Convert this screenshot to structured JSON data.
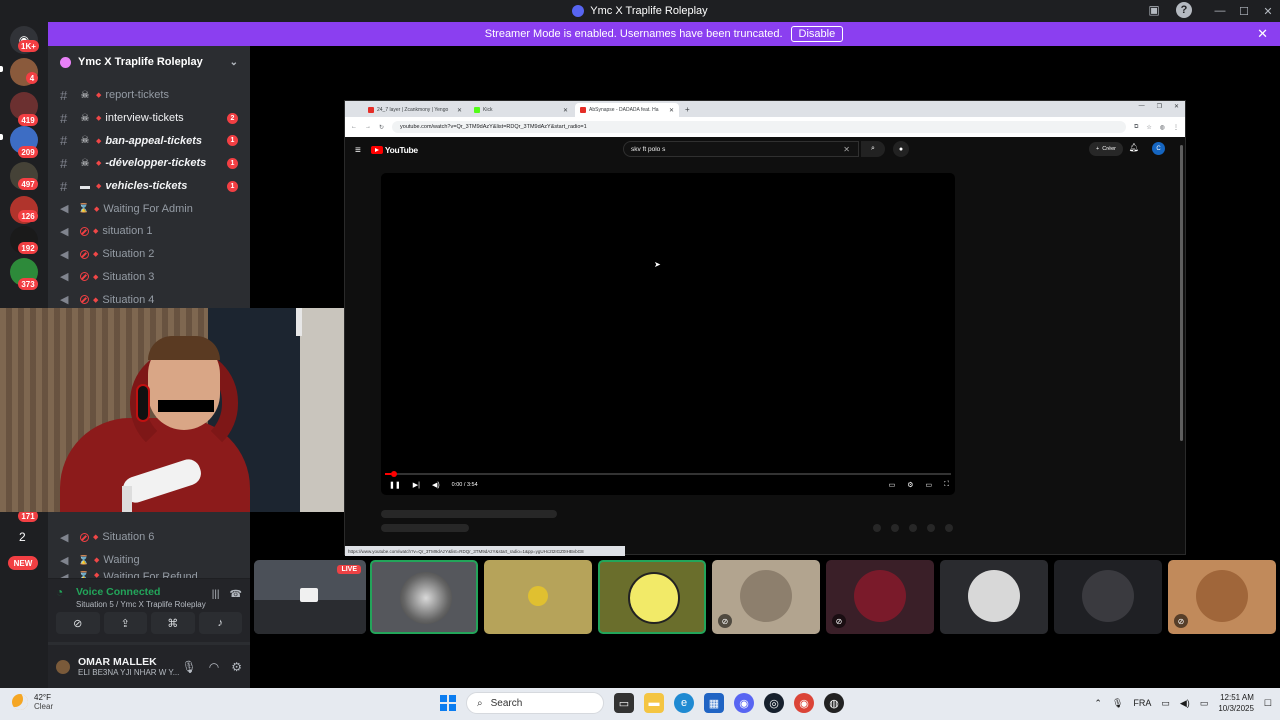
{
  "app": {
    "window_title": "Ymc X Traplife Roleplay"
  },
  "banner": {
    "text": "Streamer Mode is enabled. Usernames have been truncated.",
    "button": "Disable"
  },
  "rail": {
    "badges": [
      "1K+",
      "4",
      "419",
      "209",
      "497",
      "126",
      "192",
      "373",
      "171",
      "2",
      "NEW"
    ]
  },
  "server": {
    "name": "Ymc X Traplife Roleplay"
  },
  "channels": [
    {
      "type": "text",
      "name": "report-tickets",
      "style": "muted"
    },
    {
      "type": "text",
      "name": "interview-tickets",
      "style": "unread",
      "mentions": "2"
    },
    {
      "type": "text",
      "name": "ban-appeal-tickets",
      "style": "bolditalic",
      "mentions": "1"
    },
    {
      "type": "text",
      "name": "-développer-tickets",
      "style": "bolditalic",
      "mentions": "1"
    },
    {
      "type": "text",
      "name": "vehicles-tickets",
      "style": "bolditalic",
      "mentions": "1"
    },
    {
      "type": "voice",
      "name": "Waiting For Admin",
      "style": "muted"
    },
    {
      "type": "voice",
      "name": "situation 1",
      "style": "muted"
    },
    {
      "type": "voice",
      "name": "Situation 2",
      "style": "muted"
    },
    {
      "type": "voice",
      "name": "Situation 3",
      "style": "muted"
    },
    {
      "type": "voice",
      "name": "Situation 4",
      "style": "muted"
    }
  ],
  "channels_lower": [
    {
      "name": "Situation 6"
    },
    {
      "name": "Waiting"
    },
    {
      "name": "Waiting For Refund"
    }
  ],
  "voice": {
    "status": "Voice Connected",
    "channel": "Situation 5 / Ymc X Traplife Roleplay"
  },
  "user": {
    "name": "OMAR MALLEK",
    "status": "ELI BE3NA YJI NHAR W Y..."
  },
  "browser": {
    "tabs": [
      {
        "title": "24_7 layer | Zcankmony | Yengo"
      },
      {
        "title": "Kick"
      },
      {
        "title": "AbSynapse - DADADA feat. Ha"
      }
    ],
    "url": "youtube.com/watch?v=Qr_3TM9dAzY&list=RDQr_3TM9dAzY&start_radio=1",
    "status_url": "https://www.youtube.com/watch?v=Qr_3TM9dAzY&list=RDQr_3TM9dAzY&start_radio=1&pp=ygUHc2t2IGZ0IHBvbG8"
  },
  "youtube": {
    "logo": "YouTube",
    "search_query": "skv ft polo s",
    "create_label": "Créer",
    "avatar_letter": "C",
    "time": "0:00 / 3:54",
    "progress": 0.01
  },
  "tiles": [
    {
      "name": "stream-car",
      "live": "LIVE",
      "color": "#4b5058"
    },
    {
      "name": "user-gray",
      "speaking": true,
      "color": "#55575c"
    },
    {
      "name": "user-bee",
      "color": "#b6a35a"
    },
    {
      "name": "user-sketch",
      "speaking": true,
      "color": "#6a6e2c"
    },
    {
      "name": "user-beige",
      "muted": true,
      "color": "#b2a48f"
    },
    {
      "name": "user-red",
      "muted": true,
      "color": "#3a1f28"
    },
    {
      "name": "user-bw",
      "color": "#2a2b2f"
    },
    {
      "name": "user-sunglasses",
      "color": "#1f2024"
    },
    {
      "name": "user-cartoon",
      "muted": true,
      "color": "#c18a5b"
    }
  ],
  "taskbar": {
    "temp": "42°F",
    "weather": "Clear",
    "search": "Search",
    "lang": "FRA",
    "time": "12:51 AM",
    "date": "10/3/2025"
  }
}
